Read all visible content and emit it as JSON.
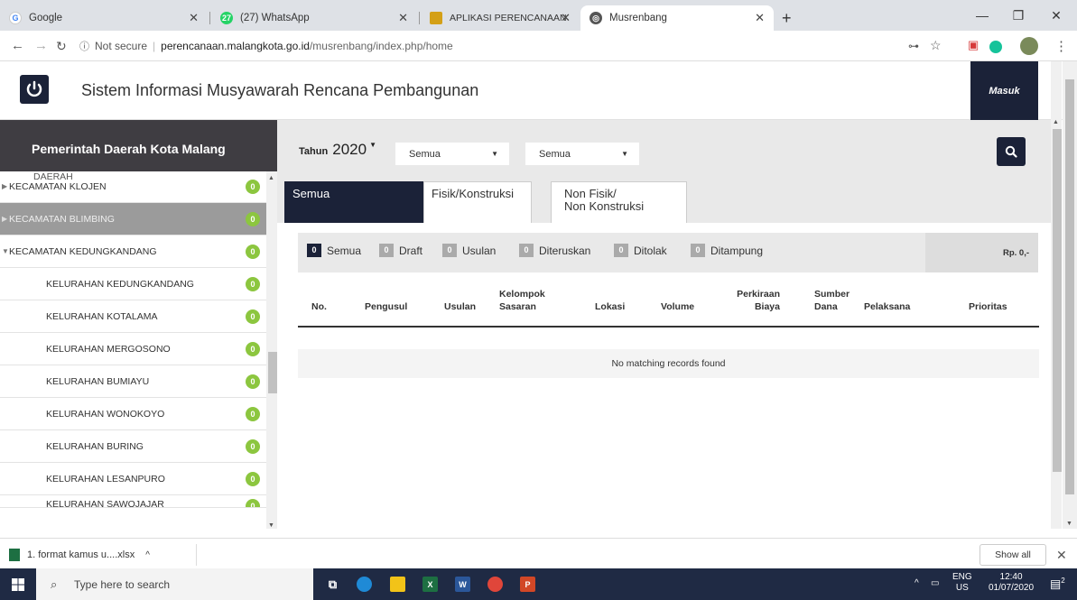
{
  "browser": {
    "tabs": [
      {
        "title": "Google",
        "active": false
      },
      {
        "title": "(27) WhatsApp",
        "active": false
      },
      {
        "title": "APLIKASI PERENCANAAN: Login",
        "active": false
      },
      {
        "title": "Musrenbang",
        "active": true
      }
    ],
    "new_tab": "+",
    "security": "Not secure",
    "url_host": "perencanaan.malangkota.go.id",
    "url_path": "/musrenbang/index.php/home",
    "whatsapp_count": "27"
  },
  "site": {
    "title": "Sistem Informasi Musyawarah Rencana Pembangunan",
    "login_label": "Masuk"
  },
  "sidebar": {
    "heading": "Pemerintah Daerah Kota Malang",
    "partial_label": "DAERAH",
    "items": [
      {
        "label": "KECAMATAN KLOJEN",
        "count": "0",
        "level": 0,
        "arrow": "▶"
      },
      {
        "label": "KECAMATAN BLIMBING",
        "count": "0",
        "level": 0,
        "arrow": "▶"
      },
      {
        "label": "KECAMATAN KEDUNGKANDANG",
        "count": "0",
        "level": 0,
        "arrow": "▼"
      },
      {
        "label": "KELURAHAN KEDUNGKANDANG",
        "count": "0",
        "level": 1
      },
      {
        "label": "KELURAHAN KOTALAMA",
        "count": "0",
        "level": 1
      },
      {
        "label": "KELURAHAN MERGOSONO",
        "count": "0",
        "level": 1
      },
      {
        "label": "KELURAHAN BUMIAYU",
        "count": "0",
        "level": 1
      },
      {
        "label": "KELURAHAN WONOKOYO",
        "count": "0",
        "level": 1
      },
      {
        "label": "KELURAHAN BURING",
        "count": "0",
        "level": 1
      },
      {
        "label": "KELURAHAN LESANPURO",
        "count": "0",
        "level": 1
      },
      {
        "label": "KELURAHAN SAWOJAJAR",
        "count": "0",
        "level": 1
      }
    ]
  },
  "filters": {
    "year_label": "Tahun",
    "year_value": "2020",
    "select1": "Semua",
    "select2": "Semua"
  },
  "type_tabs": [
    {
      "label": "Semua",
      "active": true
    },
    {
      "label": "Fisik/Konstruksi",
      "active": false
    },
    {
      "label": "Non Fisik/\nNon Konstruksi",
      "active": false
    }
  ],
  "status_filters": [
    {
      "count": "0",
      "label": "Semua",
      "active": true
    },
    {
      "count": "0",
      "label": "Draft",
      "active": false
    },
    {
      "count": "0",
      "label": "Usulan",
      "active": false
    },
    {
      "count": "0",
      "label": "Diteruskan",
      "active": false
    },
    {
      "count": "0",
      "label": "Ditolak",
      "active": false
    },
    {
      "count": "0",
      "label": "Ditampung",
      "active": false
    }
  ],
  "total": "Rp. 0,-",
  "table": {
    "headers": [
      {
        "label": "No.",
        "align": "left"
      },
      {
        "label": "Pengusul",
        "align": "left"
      },
      {
        "label": "Usulan",
        "align": "left"
      },
      {
        "label": "Kelompok\nSasaran",
        "align": "left"
      },
      {
        "label": "Lokasi",
        "align": "left"
      },
      {
        "label": "Volume",
        "align": "left"
      },
      {
        "label": "Perkiraan\nBiaya",
        "align": "right"
      },
      {
        "label": "Sumber\nDana",
        "align": "left"
      },
      {
        "label": "Pelaksana",
        "align": "left"
      },
      {
        "label": "Prioritas",
        "align": "left"
      }
    ],
    "empty_message": "No matching records found"
  },
  "downloads": {
    "file": "1. format kamus u....xlsx",
    "show_all": "Show all"
  },
  "taskbar": {
    "search_placeholder": "Type here to search",
    "lang": "ENG",
    "region": "US",
    "time": "12:40",
    "date": "01/07/2020",
    "notifications": "2"
  },
  "colors": {
    "navy": "#1b2238",
    "badge_green": "#8cc63f",
    "sidebar_head": "#3f3d42",
    "panel_grey": "#e9e9e9"
  }
}
